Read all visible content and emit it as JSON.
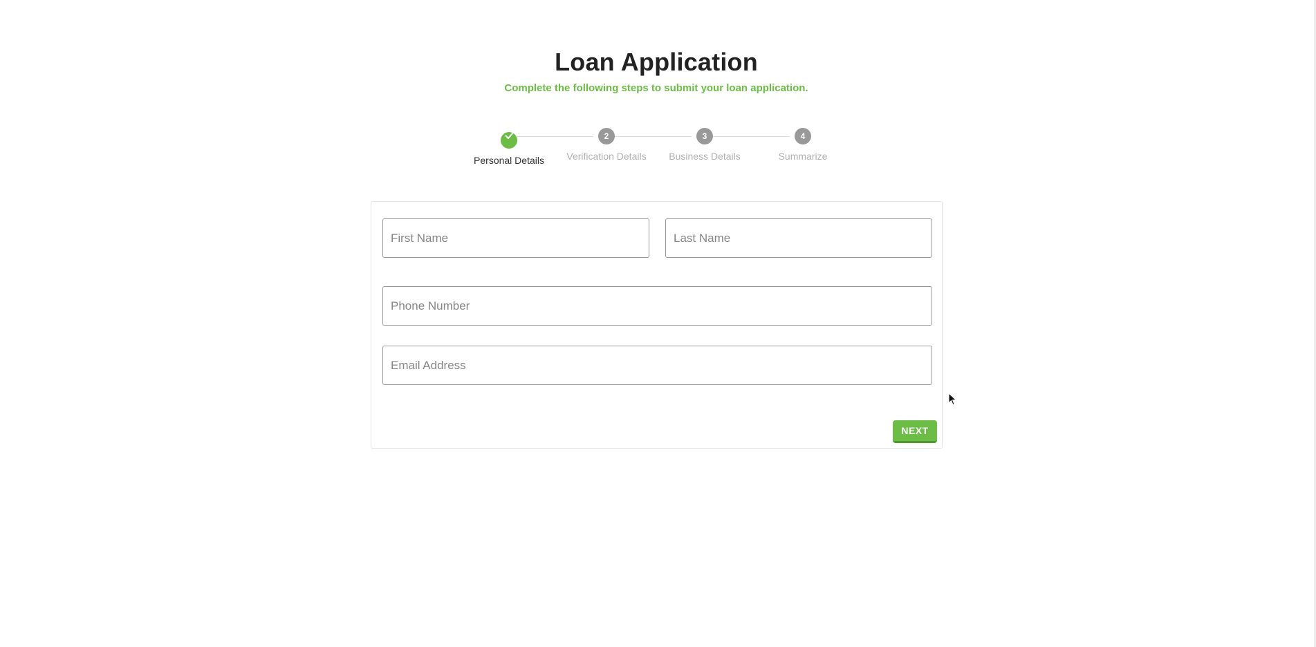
{
  "header": {
    "title": "Loan Application",
    "subtitle": "Complete the following steps to submit your loan application."
  },
  "stepper": {
    "steps": [
      {
        "number": "1",
        "label": "Personal Details",
        "status": "completed",
        "icon": "check-icon"
      },
      {
        "number": "2",
        "label": "Verification Details",
        "status": "pending"
      },
      {
        "number": "3",
        "label": "Business Details",
        "status": "pending"
      },
      {
        "number": "4",
        "label": "Summarize",
        "status": "pending"
      }
    ]
  },
  "form": {
    "first_name": {
      "placeholder": "First Name",
      "value": ""
    },
    "last_name": {
      "placeholder": "Last Name",
      "value": ""
    },
    "phone_number": {
      "placeholder": "Phone Number",
      "value": ""
    },
    "email_address": {
      "placeholder": "Email Address",
      "value": ""
    },
    "next_label": "NEXT"
  },
  "colors": {
    "accent": "#6bbd45",
    "step_pending": "#999999",
    "title": "#222222"
  }
}
